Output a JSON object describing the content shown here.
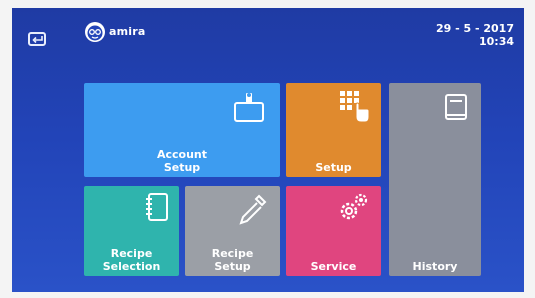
{
  "header": {
    "brand": "amira",
    "date": "29 - 5 - 2017",
    "time": "10:34"
  },
  "tiles": {
    "account_setup": "Account\nSetup",
    "setup": "Setup",
    "history": "History",
    "recipe_selection": "Recipe\nSelection",
    "recipe_setup": "Recipe\nSetup",
    "service": "Service"
  },
  "icons": {
    "back": "back-icon",
    "logo": "amira-logo-icon",
    "account": "id-card-icon",
    "setup": "keypad-touch-icon",
    "history": "book-icon",
    "recipe": "notebook-icon",
    "recipe_setup": "dropper-icon",
    "service": "gears-icon"
  },
  "colors": {
    "background": "#2244b8",
    "account_setup": "#3d9cf0",
    "setup": "#e08a2e",
    "history": "#8a8f9c",
    "recipe_selection": "#2fb4ad",
    "recipe_setup": "#9b9fa6",
    "service": "#e0457f"
  }
}
